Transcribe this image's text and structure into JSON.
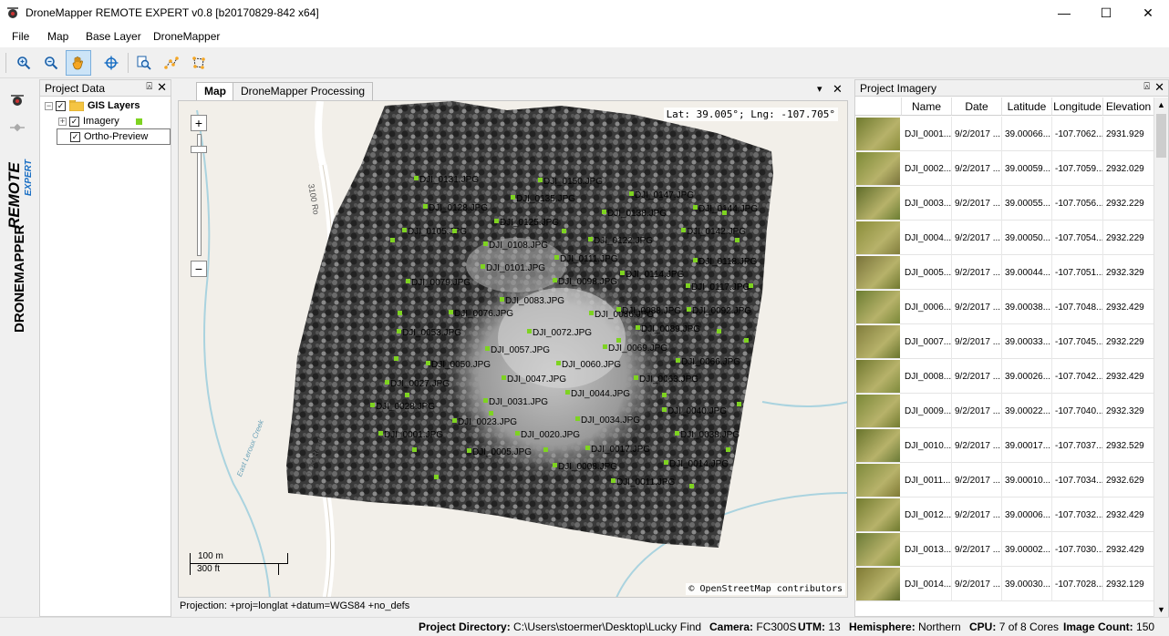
{
  "window": {
    "title": "DroneMapper REMOTE EXPERT v0.8 [b20170829-842 x64]",
    "minimize": "—",
    "maximize": "☐",
    "close": "✕"
  },
  "menu": [
    "File",
    "Map",
    "Base Layer",
    "DroneMapper"
  ],
  "toolbar": [
    {
      "name": "zoom-in-tool",
      "icon": "zoom-in-icon"
    },
    {
      "name": "zoom-out-tool",
      "icon": "zoom-out-icon"
    },
    {
      "name": "pan-tool",
      "icon": "hand-icon",
      "active": true
    },
    {
      "name": "locate-tool",
      "icon": "crosshair-icon"
    },
    {
      "name": "identify-tool",
      "icon": "identify-icon"
    },
    {
      "name": "measure-line-tool",
      "icon": "measure-line-icon"
    },
    {
      "name": "measure-area-tool",
      "icon": "measure-area-icon"
    }
  ],
  "logo": {
    "text_top": "REMOTE",
    "text_sub": "EXPERT",
    "brand": "DRONEMAPPER"
  },
  "project_data": {
    "title": "Project Data",
    "pin": "⍓",
    "close": "✕",
    "tree": {
      "root": "GIS Layers",
      "imagery": "Imagery",
      "ortho": "Ortho-Preview"
    }
  },
  "tabs": {
    "map": "Map",
    "processing": "DroneMapper Processing",
    "menu": "▾",
    "close": "✕"
  },
  "map": {
    "coords": "Lat: 39.005°; Lng: -107.705°",
    "attribution": "© OpenStreetMap contributors",
    "scale_m": "100 m",
    "scale_ft": "300 ft",
    "zoom_in": "+",
    "zoom_out": "−",
    "road_labels": [
      "3100 Ro",
      "3100 Road",
      "East Leroux Creek"
    ],
    "image_labels": [
      {
        "t": "DJI_0131.JPG"
      },
      {
        "t": "DJI_0150.JPG"
      },
      {
        "t": "DJI_0135.JPG"
      },
      {
        "t": "DJI_0147.JPG"
      },
      {
        "t": "DJI_0128.JPG"
      },
      {
        "t": "DJI_0138.JPG"
      },
      {
        "t": "DJI_0144.JPG"
      },
      {
        "t": "DJI_0125.JPG"
      },
      {
        "t": "DJI_0105.JPG"
      },
      {
        "t": "DJI_0108.JPG"
      },
      {
        "t": "DJI_0122.JPG"
      },
      {
        "t": "DJI_0142.JPG"
      },
      {
        "t": "DJI_0101.JPG"
      },
      {
        "t": "DJI_0111.JPG"
      },
      {
        "t": "DJI_0118.JPG"
      },
      {
        "t": "DJI_0114.JPG"
      },
      {
        "t": "DJI_0079.JPG"
      },
      {
        "t": "DJI_0098.JPG"
      },
      {
        "t": "DJI_0117.JPG"
      },
      {
        "t": "DJI_0083.JPG"
      },
      {
        "t": "DJI_0086.JPG"
      },
      {
        "t": "DJI_0076.JPG"
      },
      {
        "t": "DJI_0088.JPG"
      },
      {
        "t": "DJI_0092.JPG"
      },
      {
        "t": "DJI_0053.JPG"
      },
      {
        "t": "DJI_0072.JPG"
      },
      {
        "t": "DJI_0089.JPG"
      },
      {
        "t": "DJI_0057.JPG"
      },
      {
        "t": "DJI_0069.JPG"
      },
      {
        "t": "DJI_0066.JPG"
      },
      {
        "t": "DJI_0050.JPG"
      },
      {
        "t": "DJI_0060.JPG"
      },
      {
        "t": "DJI_0027.JPG"
      },
      {
        "t": "DJI_0047.JPG"
      },
      {
        "t": "DJI_0063.JPG"
      },
      {
        "t": "DJI_0044.JPG"
      },
      {
        "t": "DJI_0028.JPG"
      },
      {
        "t": "DJI_0031.JPG"
      },
      {
        "t": "DJI_0040.JPG"
      },
      {
        "t": "DJI_0023.JPG"
      },
      {
        "t": "DJI_0034.JPG"
      },
      {
        "t": "DJI_0001.JPG"
      },
      {
        "t": "DJI_0020.JPG"
      },
      {
        "t": "DJI_0038.JPG"
      },
      {
        "t": "DJI_0005.JPG"
      },
      {
        "t": "DJI_0017.JPG"
      },
      {
        "t": "DJI_0008.JPG"
      },
      {
        "t": "DJI_0014.JPG"
      },
      {
        "t": "DJI_0011.JPG"
      }
    ]
  },
  "projection": "Projection: +proj=longlat +datum=WGS84 +no_defs",
  "imagery": {
    "title": "Project Imagery",
    "pin": "⍓",
    "close": "✕",
    "columns": [
      "Name",
      "Date",
      "Latitude",
      "Longitude",
      "Elevation"
    ],
    "rows": [
      [
        "DJI_0001...",
        "9/2/2017 ...",
        "39.00066...",
        "-107.7062...",
        "2931.929"
      ],
      [
        "DJI_0002...",
        "9/2/2017 ...",
        "39.00059...",
        "-107.7059...",
        "2932.029"
      ],
      [
        "DJI_0003...",
        "9/2/2017 ...",
        "39.00055...",
        "-107.7056...",
        "2932.229"
      ],
      [
        "DJI_0004...",
        "9/2/2017 ...",
        "39.00050...",
        "-107.7054...",
        "2932.229"
      ],
      [
        "DJI_0005...",
        "9/2/2017 ...",
        "39.00044...",
        "-107.7051...",
        "2932.329"
      ],
      [
        "DJI_0006...",
        "9/2/2017 ...",
        "39.00038...",
        "-107.7048...",
        "2932.429"
      ],
      [
        "DJI_0007...",
        "9/2/2017 ...",
        "39.00033...",
        "-107.7045...",
        "2932.229"
      ],
      [
        "DJI_0008...",
        "9/2/2017 ...",
        "39.00026...",
        "-107.7042...",
        "2932.429"
      ],
      [
        "DJI_0009...",
        "9/2/2017 ...",
        "39.00022...",
        "-107.7040...",
        "2932.329"
      ],
      [
        "DJI_0010...",
        "9/2/2017 ...",
        "39.00017...",
        "-107.7037...",
        "2932.529"
      ],
      [
        "DJI_0011...",
        "9/2/2017 ...",
        "39.00010...",
        "-107.7034...",
        "2932.629"
      ],
      [
        "DJI_0012...",
        "9/2/2017 ...",
        "39.00006...",
        "-107.7032...",
        "2932.429"
      ],
      [
        "DJI_0013...",
        "9/2/2017 ...",
        "39.00002...",
        "-107.7030...",
        "2932.429"
      ],
      [
        "DJI_0014...",
        "9/2/2017 ...",
        "39.00030...",
        "-107.7028...",
        "2932.129"
      ]
    ]
  },
  "status": {
    "dir_label": "Project Directory:",
    "dir_value": "C:\\Users\\stoermer\\Desktop\\Lucky Find",
    "camera_label": "Camera:",
    "camera_value": "FC300S",
    "utm_label": "UTM:",
    "utm_value": "13",
    "hemi_label": "Hemisphere:",
    "hemi_value": "Northern",
    "cpu_label": "CPU:",
    "cpu_value": "7 of 8 Cores",
    "count_label": "Image Count:",
    "count_value": "150"
  },
  "colors": {
    "marker": "#7ed321",
    "accent": "#0078d7",
    "map_bg": "#f2efe9",
    "water": "#aad3df"
  }
}
